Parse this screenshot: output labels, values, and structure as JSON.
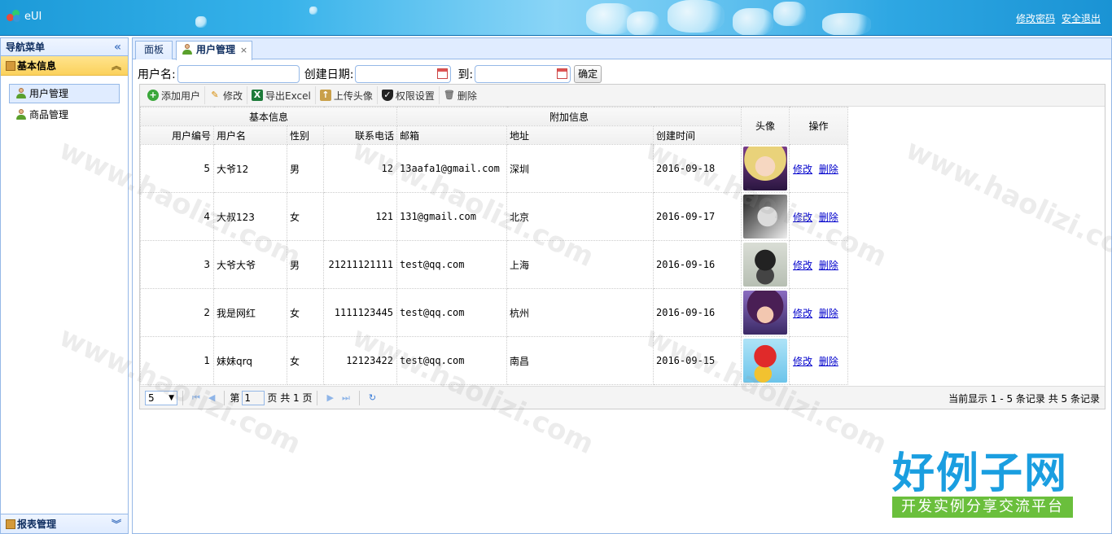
{
  "header": {
    "app_name": "eUI",
    "link_change_pwd": "修改密码",
    "link_logout": "安全退出"
  },
  "west": {
    "title": "导航菜单",
    "collapse_glyph": "«",
    "accordion_main": "基本信息",
    "items": [
      {
        "label": "用户管理"
      },
      {
        "label": "商品管理"
      }
    ],
    "accordion_bottom": "报表管理"
  },
  "tabs": [
    {
      "label": "面板"
    },
    {
      "label": "用户管理"
    }
  ],
  "search": {
    "username_label": "用户名:",
    "date_label": "创建日期:",
    "to_label": "到:",
    "submit_label": "确定"
  },
  "toolbar": {
    "add": "添加用户",
    "edit": "修改",
    "export": "导出Excel",
    "upload": "上传头像",
    "perm": "权限设置",
    "delete": "删除"
  },
  "grid": {
    "group_basic": "基本信息",
    "group_extra": "附加信息",
    "col_avatar": "头像",
    "col_ops": "操作",
    "columns": [
      "用户编号",
      "用户名",
      "性别",
      "联系电话",
      "邮箱",
      "地址",
      "创建时间"
    ],
    "rows": [
      {
        "id": "5",
        "name": "大爷12",
        "gender": "男",
        "phone": "12",
        "email": "13aafa1@gmail.com",
        "address": "深圳",
        "created": "2016-09-18",
        "edit": "修改",
        "del": "删除",
        "avatar": "avatar-girl-blonde"
      },
      {
        "id": "4",
        "name": "大叔123",
        "gender": "女",
        "phone": "121",
        "email": "131@gmail.com",
        "address": "北京",
        "created": "2016-09-17",
        "edit": "修改",
        "del": "删除",
        "avatar": "avatar-bw-portrait"
      },
      {
        "id": "3",
        "name": "大爷大爷",
        "gender": "男",
        "phone": "21211121111",
        "email": "test@qq.com",
        "address": "上海",
        "created": "2016-09-16",
        "edit": "修改",
        "del": "删除",
        "avatar": "avatar-black-creature"
      },
      {
        "id": "2",
        "name": "我是网红",
        "gender": "女",
        "phone": "1111123445",
        "email": "test@qq.com",
        "address": "杭州",
        "created": "2016-09-16",
        "edit": "修改",
        "del": "删除",
        "avatar": "avatar-purple-girl"
      },
      {
        "id": "1",
        "name": "妹妹qrq",
        "gender": "女",
        "phone": "12123422",
        "email": "test@qq.com",
        "address": "南昌",
        "created": "2016-09-15",
        "edit": "修改",
        "del": "删除",
        "avatar": "avatar-red-character"
      }
    ]
  },
  "pager": {
    "page_size": "5",
    "page_prefix": "第",
    "page_value": "1",
    "page_suffix": "页 共 1 页",
    "info": "当前显示 1 - 5 条记录 共 5 条记录"
  },
  "watermark": {
    "text": "www.haolizi.com",
    "brand_big": "好例子网",
    "brand_small": "开发实例分享交流平台"
  }
}
